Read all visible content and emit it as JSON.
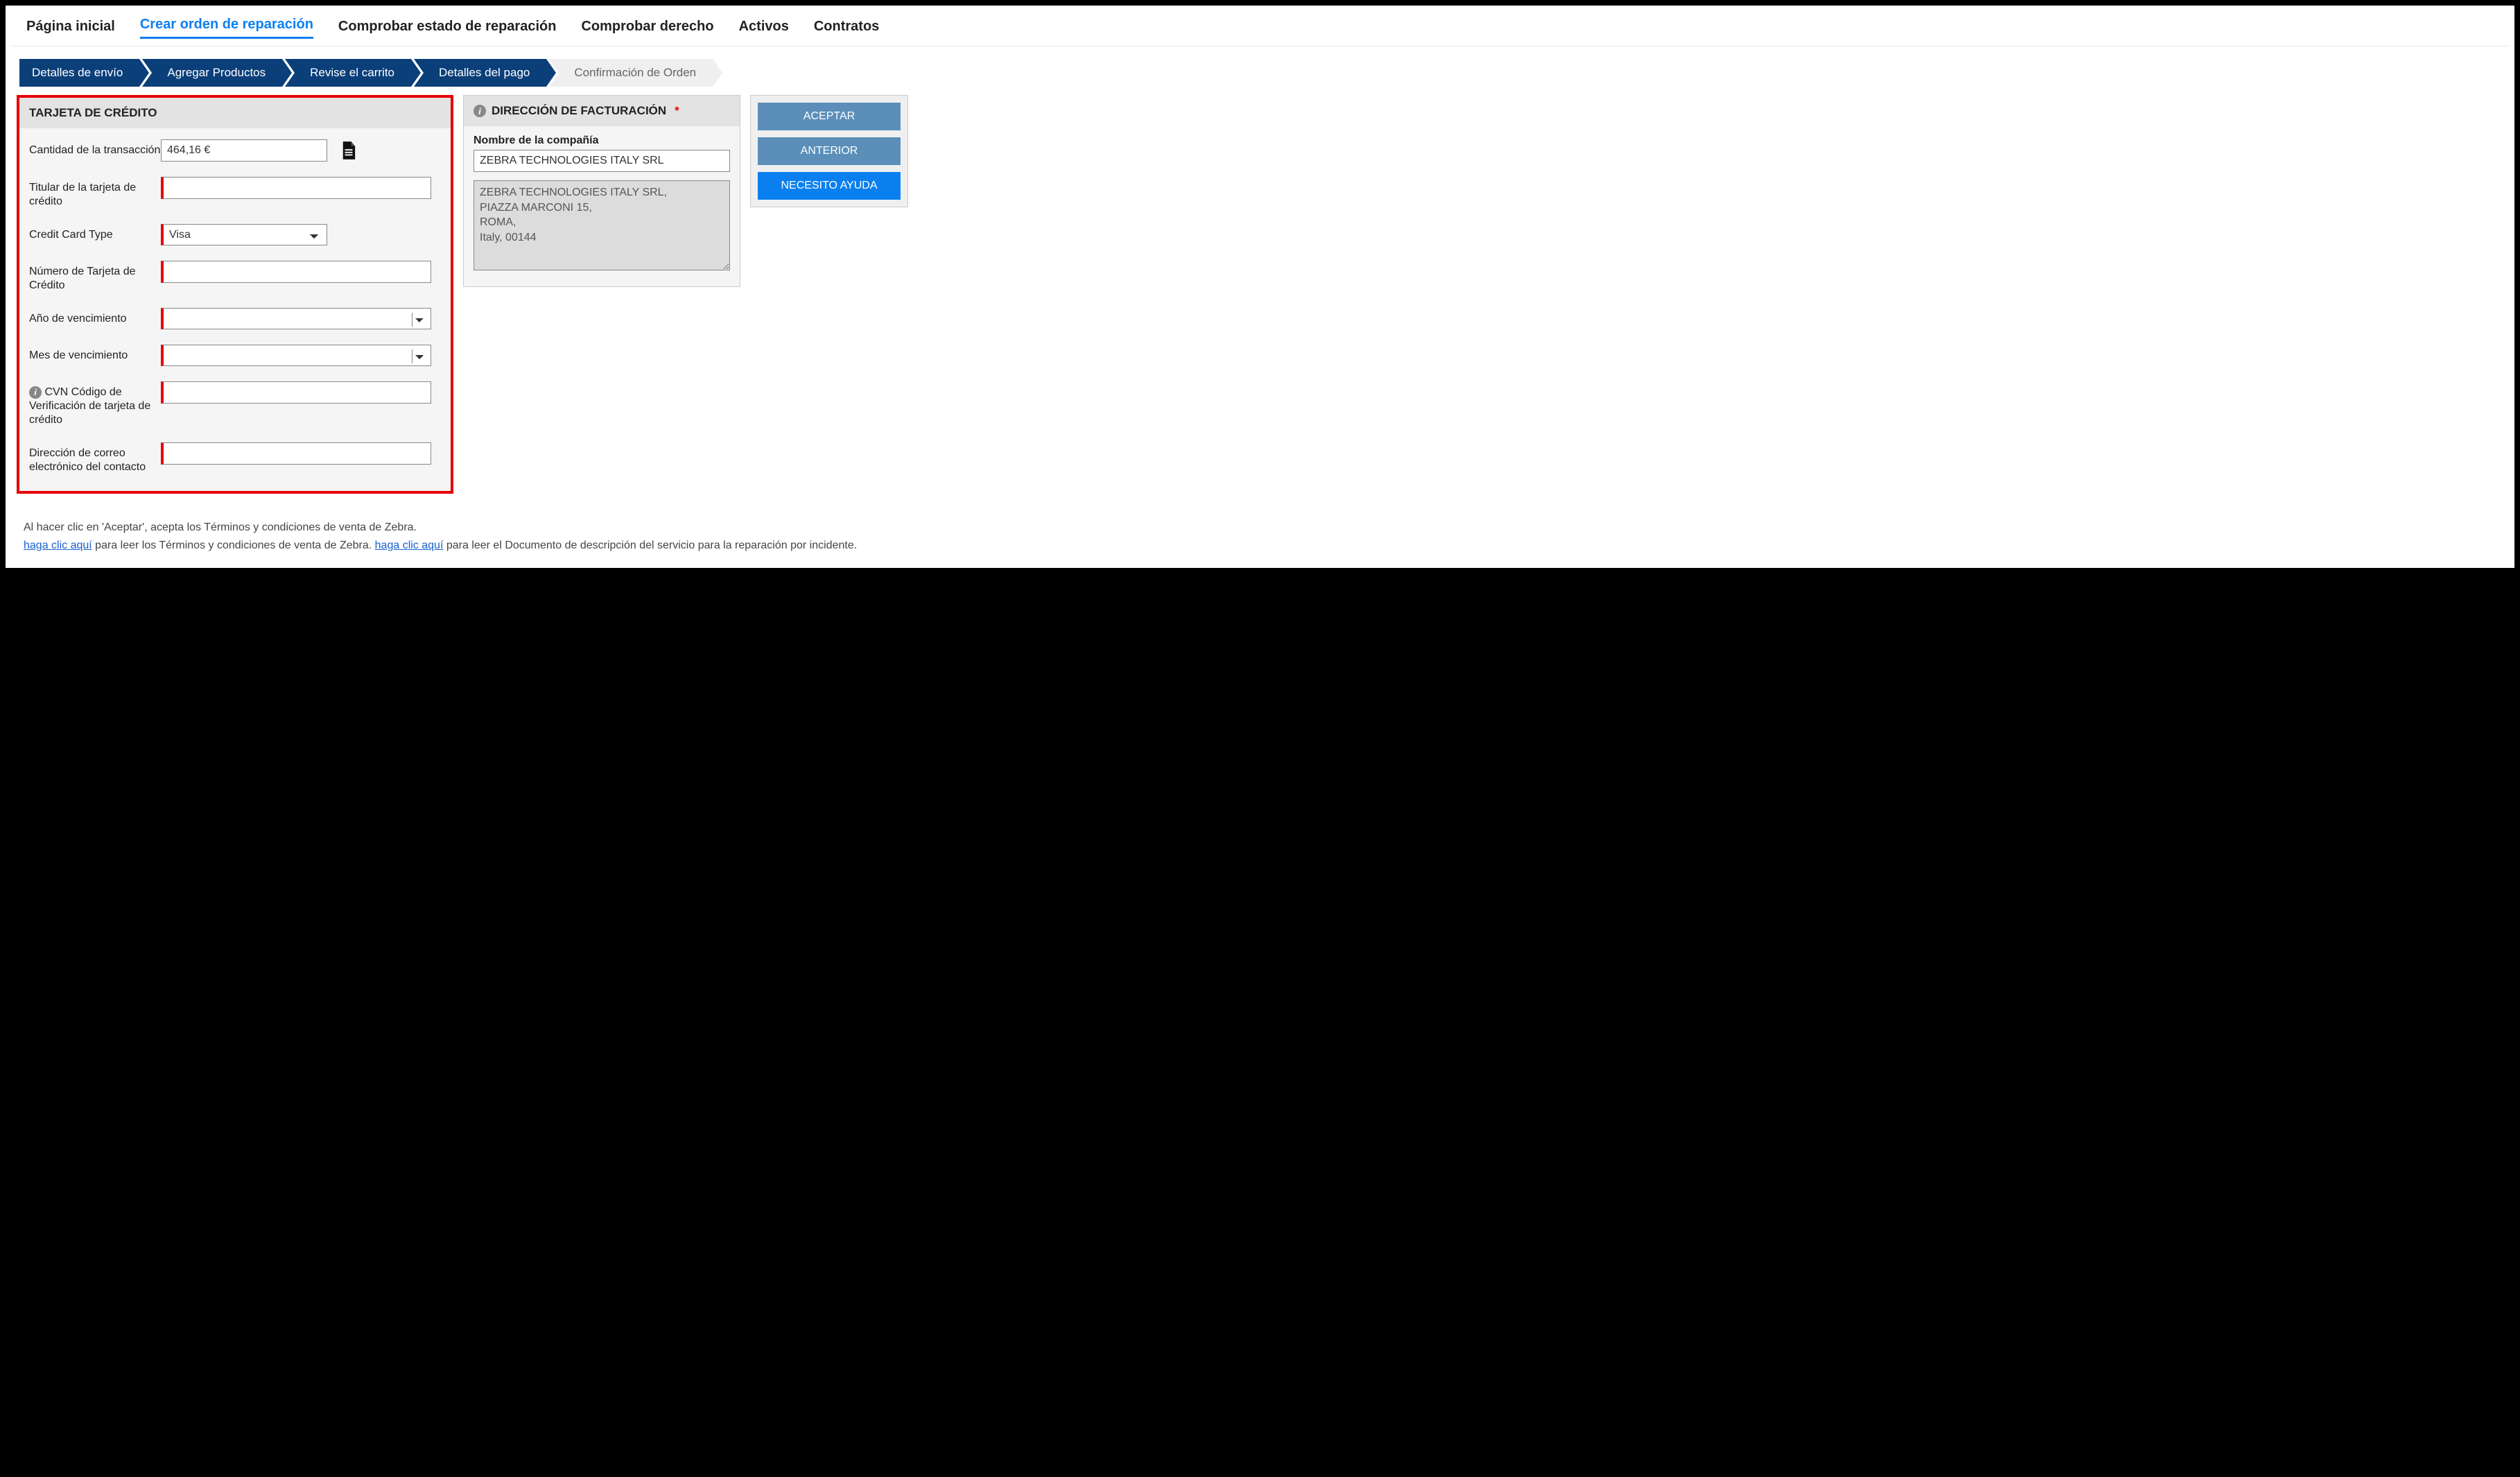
{
  "nav": {
    "home": "Página inicial",
    "create": "Crear orden de reparación",
    "status": "Comprobar estado de reparación",
    "entitle": "Comprobar derecho",
    "assets": "Activos",
    "contracts": "Contratos"
  },
  "steps": {
    "s1": "Detalles de envío",
    "s2": "Agregar Productos",
    "s3": "Revise el carrito",
    "s4": "Detalles del pago",
    "s5": "Confirmación de Orden"
  },
  "cc": {
    "header": "TARJETA DE CRÉDITO",
    "amount_label": "Cantidad de la transacción",
    "amount_value": "464,16 €",
    "holder_label": "Titular de la tarjeta de crédito",
    "type_label": "Credit Card Type",
    "type_value": "Visa",
    "number_label": "Número de Tarjeta de Crédito",
    "exp_year_label": "Año de vencimiento",
    "exp_month_label": "Mes de vencimiento",
    "cvn_label": "CVN Código de Verificación de tarjeta de crédito",
    "email_label": "Dirección de correo electrónico del contacto"
  },
  "billing": {
    "header": "DIRECCIÓN DE FACTURACIÓN",
    "company_label": "Nombre de la compañía",
    "company_value": "ZEBRA TECHNOLOGIES ITALY SRL",
    "address_value": "ZEBRA TECHNOLOGIES ITALY SRL,\nPIAZZA MARCONI 15,\nROMA,\nItaly, 00144"
  },
  "actions": {
    "accept": "ACEPTAR",
    "prev": "ANTERIOR",
    "help": "NECESITO AYUDA"
  },
  "footer": {
    "line1_a": "Al hacer clic en 'Aceptar', acepta los Términos y condiciones de venta de Zebra.",
    "link1": "haga clic aquí",
    "line2_a": " para leer los Términos y condiciones de venta de Zebra.  ",
    "link2": "haga clic aquí",
    "line2_b": " para leer el Documento de descripción del servicio para la reparación por incidente."
  }
}
